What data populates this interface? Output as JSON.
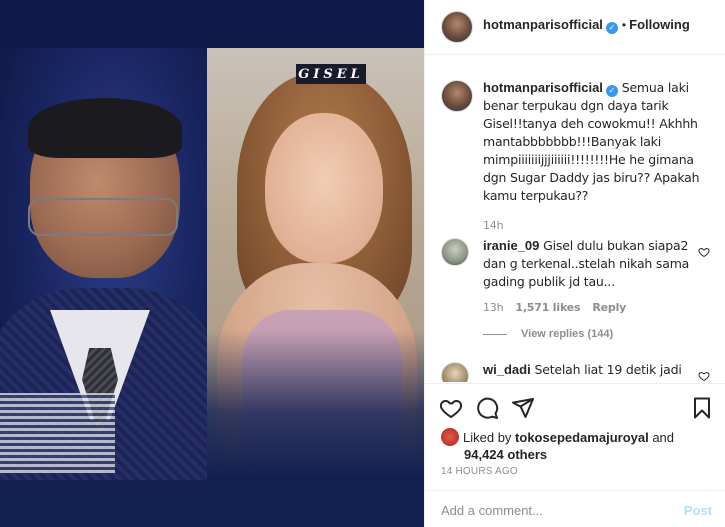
{
  "media": {
    "name_tag": "GISEL"
  },
  "header": {
    "username": "hotmanparisofficial",
    "separator": "•",
    "follow_status": "Following"
  },
  "caption": {
    "username": "hotmanparisofficial",
    "text": "Semua laki benar terpukau dgn daya tarik Gisel!!tanya deh cowokmu!! Akhhh mantabbbbbbb!!!Banyak laki mimpiiiiiiijjjiiiiii!!!!!!!!He he gimana dgn Sugar Daddy jas biru?? Apakah kamu terpukau??",
    "time": "14h"
  },
  "comments": [
    {
      "username": "iranie_09",
      "text": "Gisel dulu bukan siapa2 dan g terkenal..stelah nikah sama gading publik jd tau...",
      "time": "13h",
      "likes": "1,571 likes",
      "reply_label": "Reply",
      "view_replies": "View replies (144)"
    },
    {
      "username": "wi_dadi",
      "text": "Setelah liat 19 detik jadi"
    }
  ],
  "actions": {
    "liked_by_prefix": "Liked by",
    "liked_by_user": "tokosepedamajuroyal",
    "liked_by_and": "and",
    "likes_count": "94,424 others",
    "timestamp": "14 HOURS AGO"
  },
  "add_comment": {
    "placeholder": "Add a comment...",
    "post_label": "Post"
  },
  "colors": {
    "verified_blue": "#3897f0",
    "post_disabled": "#b2dffc",
    "media_navy": "#0e1a4a"
  },
  "icons": [
    "verified-badge-icon",
    "heart-icon",
    "comment-icon",
    "share-icon",
    "bookmark-icon",
    "small-heart-icon"
  ]
}
